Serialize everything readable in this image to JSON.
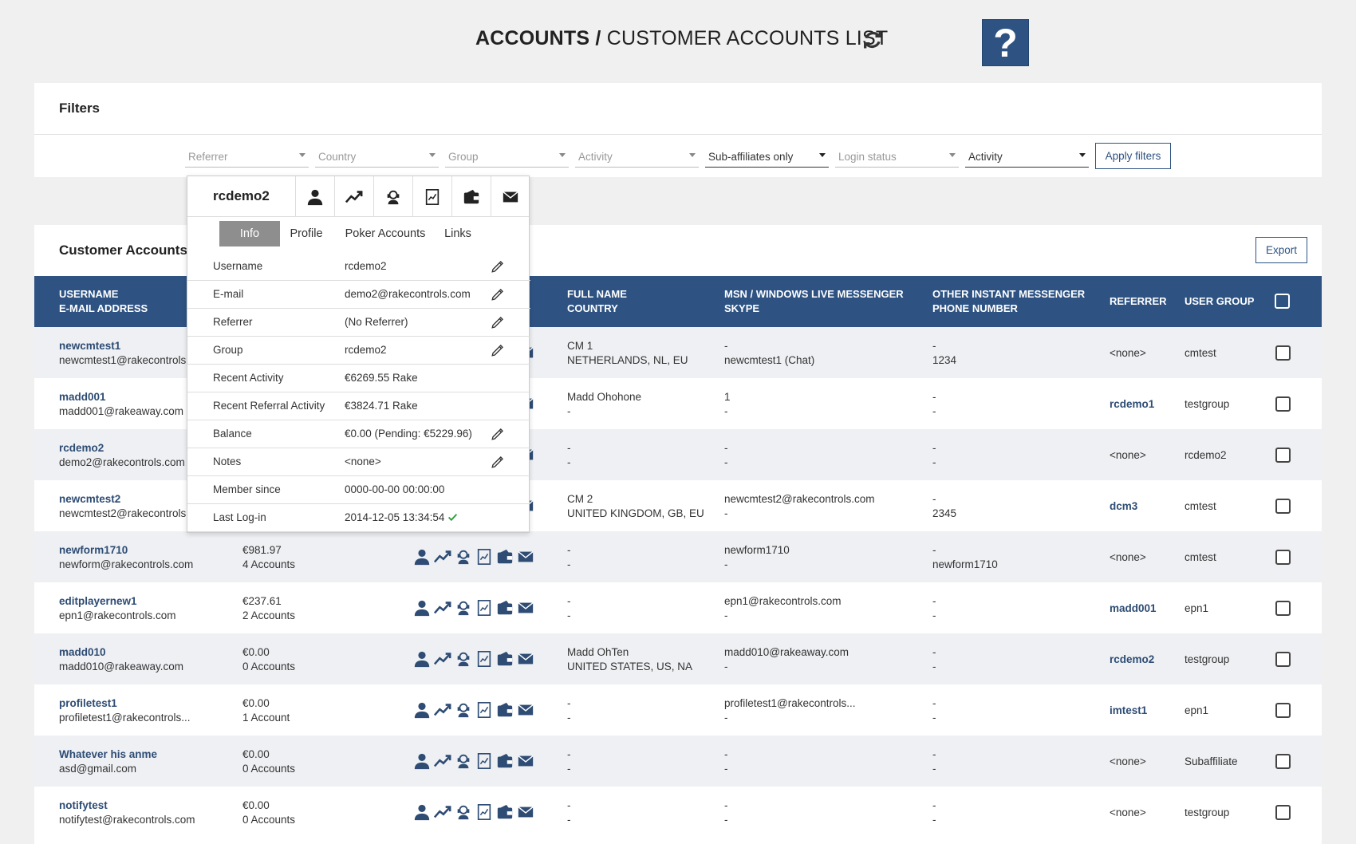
{
  "header": {
    "title_bold": "ACCOUNTS /",
    "title_rest": " CUSTOMER ACCOUNTS LIST",
    "help_label": "?"
  },
  "filters": {
    "title": "Filters",
    "selects": [
      {
        "label": "Referrer"
      },
      {
        "label": "Country"
      },
      {
        "label": "Group"
      },
      {
        "label": "Activity"
      },
      {
        "label": "Sub-affiliates only"
      },
      {
        "label": "Login status"
      },
      {
        "label": "Activity"
      }
    ],
    "apply_label": "Apply filters"
  },
  "accounts": {
    "title": "Customer Accounts",
    "export_label": "Export",
    "headers": {
      "username": "USERNAME",
      "email": "E-MAIL ADDRESS",
      "fullname": "FULL NAME",
      "country": "COUNTRY",
      "msn": "MSN / WINDOWS LIVE MESSENGER",
      "skype": "SKYPE",
      "im": "OTHER INSTANT MESSENGER",
      "phone": "PHONE NUMBER",
      "referrer": "REFERRER",
      "group": "USER GROUP"
    },
    "rows": [
      {
        "username": "newcmtest1",
        "email": "newcmtest1@rakecontrols",
        "balance": "",
        "accounts": "",
        "fullname": "CM 1",
        "country": "NETHERLANDS, NL, EU",
        "msn": "-",
        "skype": "newcmtest1 (Chat)",
        "im": "-",
        "phone": "1234",
        "referrer": "<none>",
        "group": "cmtest"
      },
      {
        "username": "madd001",
        "email": "madd001@rakeaway.com",
        "balance": "",
        "accounts": "",
        "fullname": "Madd Ohohone",
        "country": "-",
        "msn": "1",
        "skype": "-",
        "im": "-",
        "phone": "-",
        "referrer": "rcdemo1",
        "group": "testgroup"
      },
      {
        "username": "rcdemo2",
        "email": "demo2@rakecontrols.com",
        "balance": "",
        "accounts": "",
        "fullname": "-",
        "country": "-",
        "msn": "-",
        "skype": "-",
        "im": "-",
        "phone": "-",
        "referrer": "<none>",
        "group": "rcdemo2"
      },
      {
        "username": "newcmtest2",
        "email": "newcmtest2@rakecontrols",
        "balance": "",
        "accounts": "",
        "fullname": "CM 2",
        "country": "UNITED KINGDOM, GB, EU",
        "msn": "newcmtest2@rakecontrols.com",
        "skype": "-",
        "im": "-",
        "phone": "2345",
        "referrer": "dcm3",
        "group": "cmtest"
      },
      {
        "username": "newform1710",
        "email": "newform@rakecontrols.com",
        "balance": "€981.97",
        "accounts": "4 Accounts",
        "fullname": "-",
        "country": "-",
        "msn": "newform1710",
        "skype": "-",
        "im": "-",
        "phone": "newform1710",
        "referrer": "<none>",
        "group": "cmtest"
      },
      {
        "username": "editplayernew1",
        "email": "epn1@rakecontrols.com",
        "balance": "€237.61",
        "accounts": "2 Accounts",
        "fullname": "-",
        "country": "-",
        "msn": "epn1@rakecontrols.com",
        "skype": "-",
        "im": "-",
        "phone": "-",
        "referrer": "madd001",
        "group": "epn1"
      },
      {
        "username": "madd010",
        "email": "madd010@rakeaway.com",
        "balance": "€0.00",
        "accounts": "0 Accounts",
        "fullname": "Madd OhTen",
        "country": "UNITED STATES, US, NA",
        "msn": "madd010@rakeaway.com",
        "skype": "-",
        "im": "-",
        "phone": "-",
        "referrer": "rcdemo2",
        "group": "testgroup"
      },
      {
        "username": "profiletest1",
        "email": "profiletest1@rakecontrols...",
        "balance": "€0.00",
        "accounts": "1 Account",
        "fullname": "-",
        "country": "-",
        "msn": "profiletest1@rakecontrols...",
        "skype": "-",
        "im": "-",
        "phone": "-",
        "referrer": "imtest1",
        "group": "epn1"
      },
      {
        "username": "Whatever his anme",
        "email": "asd@gmail.com",
        "balance": "€0.00",
        "accounts": "0 Accounts",
        "fullname": "-",
        "country": "-",
        "msn": "-",
        "skype": "-",
        "im": "-",
        "phone": "-",
        "referrer": "<none>",
        "group": "Subaffiliate"
      },
      {
        "username": "notifytest",
        "email": "notifytest@rakecontrols.com",
        "balance": "€0.00",
        "accounts": "0 Accounts",
        "fullname": "-",
        "country": "-",
        "msn": "-",
        "skype": "-",
        "im": "-",
        "phone": "-",
        "referrer": "<none>",
        "group": "testgroup"
      }
    ]
  },
  "popup": {
    "name": "rcdemo2",
    "tabs": [
      "Info",
      "Profile",
      "Poker Accounts",
      "Links"
    ],
    "fields": [
      {
        "label": "Username",
        "value": "rcdemo2"
      },
      {
        "label": "E-mail",
        "value": "demo2@rakecontrols.com"
      },
      {
        "label": "Referrer",
        "value": "(No Referrer)"
      },
      {
        "label": "Group",
        "value": "rcdemo2"
      },
      {
        "label": "Recent Activity",
        "value": "€6269.55 Rake"
      },
      {
        "label": "Recent Referral Activity",
        "value": "€3824.71 Rake"
      },
      {
        "label": "Balance",
        "value": "€0.00 (Pending: €5229.96)"
      },
      {
        "label": "Notes",
        "value": "<none>"
      },
      {
        "label": "Member since",
        "value": "0000-00-00 00:00:00"
      },
      {
        "label": "Last Log-in",
        "value": "2014-12-05 13:34:54"
      }
    ]
  },
  "colors": {
    "accent": "#2e5383",
    "header_bg": "#2e5383",
    "ok": "#2e9a3c"
  }
}
